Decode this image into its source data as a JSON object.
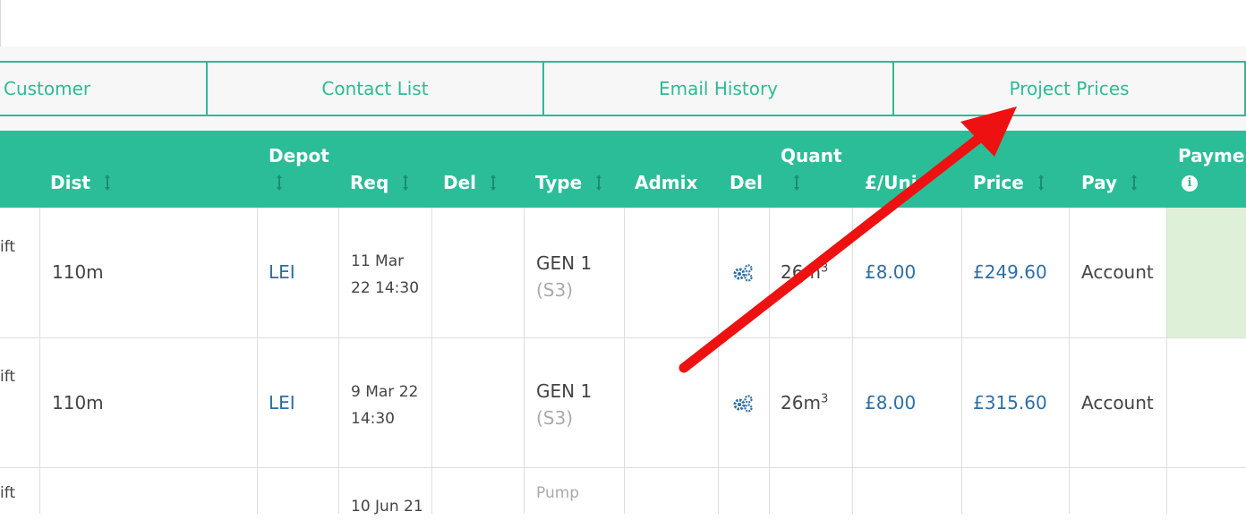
{
  "tabs": [
    {
      "label": "Customer"
    },
    {
      "label": "Contact List"
    },
    {
      "label": "Email History"
    },
    {
      "label": "Project Prices"
    }
  ],
  "table": {
    "headers": {
      "dist": "Dist",
      "depot": "Depot",
      "req": "Req",
      "del": "Del",
      "type": "Type",
      "admix": "Admix",
      "del2": "Del",
      "quant": "Quant",
      "unit": "£/Uni",
      "price": "Price",
      "pay": "Pay",
      "payment": "Paymen"
    },
    "rows": [
      {
        "left": "ift",
        "dist": "110m",
        "depot": "LEI",
        "req_line1": "11 Mar",
        "req_line2": "22 14:30",
        "type": "GEN 1",
        "type_sub": "(S3)",
        "quant": "26m",
        "quant_sup": "3",
        "unit": "£8.00",
        "price": "£249.60",
        "pay": "Account"
      },
      {
        "left": "ift",
        "dist": "110m",
        "depot": "LEI",
        "req_line1": "9 Mar 22",
        "req_line2": "14:30",
        "type": "GEN 1",
        "type_sub": "(S3)",
        "quant": "26m",
        "quant_sup": "3",
        "unit": "£8.00",
        "price": "£315.60",
        "pay": "Account"
      },
      {
        "left": "ift",
        "req_line1": "10 Jun 21",
        "type_sub": "Pump"
      }
    ]
  },
  "colors": {
    "accent": "#2bbd98",
    "link": "#2f6ea5",
    "arrow": "#ee1111",
    "paid_bg": "#dff0d8"
  },
  "icons": {
    "sort": "sort-arrows-icon",
    "gear": "gears-icon",
    "info": "info-circle-icon"
  }
}
